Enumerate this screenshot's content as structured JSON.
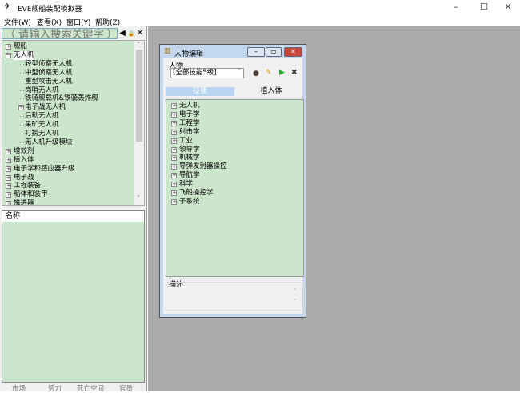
{
  "app": {
    "title": "EVE舰船装配模拟器"
  },
  "window_controls": {
    "minimize": "–",
    "maximize": "☐",
    "close": "✕"
  },
  "menu": [
    "文件(W)",
    "查看(X)",
    "窗口(Y)",
    "帮助(Z)"
  ],
  "search": {
    "placeholder": "（ 请输入搜索关键字 ）",
    "buttons": [
      "◀",
      "🔒",
      "✕"
    ]
  },
  "tree": [
    {
      "label": "舰船",
      "level": 0,
      "expander": "+"
    },
    {
      "label": "无人机",
      "level": 0,
      "expander": "-",
      "selected": true
    },
    {
      "label": "轻型侦察无人机",
      "level": 1
    },
    {
      "label": "中型侦察无人机",
      "level": 1
    },
    {
      "label": "重型攻击无人机",
      "level": 1
    },
    {
      "label": "岗哨无人机",
      "level": 1
    },
    {
      "label": "铁骑舰载机&铁骑轰炸舰",
      "level": 1
    },
    {
      "label": "电子战无人机",
      "level": 1,
      "expander": "+"
    },
    {
      "label": "后勤无人机",
      "level": 1
    },
    {
      "label": "采矿无人机",
      "level": 1
    },
    {
      "label": "打捞无人机",
      "level": 1
    },
    {
      "label": "无人机升级模块",
      "level": 1
    },
    {
      "label": "增效剂",
      "level": 0,
      "expander": "+"
    },
    {
      "label": "植入体",
      "level": 0,
      "expander": "+"
    },
    {
      "label": "电子学和感应器升级",
      "level": 0,
      "expander": "+"
    },
    {
      "label": "电子战",
      "level": 0,
      "expander": "+"
    },
    {
      "label": "工程装备",
      "level": 0,
      "expander": "+"
    },
    {
      "label": "船体和装甲",
      "level": 0,
      "expander": "+"
    },
    {
      "label": "推进器",
      "level": 0,
      "expander": "+"
    }
  ],
  "list": {
    "header": "名称"
  },
  "bottom_tabs": [
    "市场",
    "势力",
    "死亡空间",
    "官员"
  ],
  "dialog": {
    "title": "人物编辑",
    "character_label": "人物",
    "character_value": "[全部技能5级]",
    "tabs": [
      {
        "label": "技能",
        "active": true
      },
      {
        "label": "植入体",
        "active": false
      }
    ],
    "skills": [
      "无人机",
      "电子学",
      "工程学",
      "射击学",
      "工业",
      "领导学",
      "机械学",
      "导弹发射器操控",
      "导航学",
      "科学",
      "飞船操控学",
      "子系统"
    ],
    "description_label": "描述"
  },
  "colors": {
    "panel_green": "#cce6cc",
    "workspace_gray": "#ababab",
    "dialog_frame": "#c3d8ee",
    "close_red": "#c9463d"
  }
}
